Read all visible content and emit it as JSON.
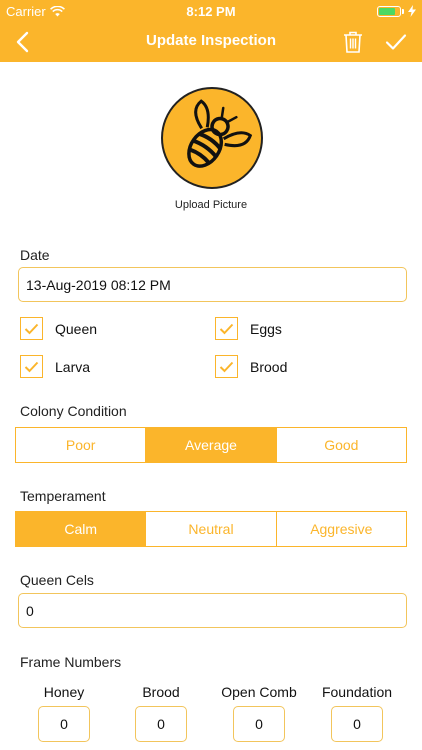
{
  "status_bar": {
    "carrier": "Carrier",
    "time": "8:12 PM"
  },
  "nav": {
    "title": "Update Inspection"
  },
  "photo": {
    "upload_label": "Upload Picture"
  },
  "date": {
    "label": "Date",
    "value": "13-Aug-2019 08:12 PM"
  },
  "checks": [
    {
      "label": "Queen",
      "checked": true
    },
    {
      "label": "Eggs",
      "checked": true
    },
    {
      "label": "Larva",
      "checked": true
    },
    {
      "label": "Brood",
      "checked": true
    }
  ],
  "colony_condition": {
    "label": "Colony Condition",
    "options": [
      "Poor",
      "Average",
      "Good"
    ],
    "selected": "Average"
  },
  "temperament": {
    "label": "Temperament",
    "options": [
      "Calm",
      "Neutral",
      "Aggresive"
    ],
    "selected": "Calm"
  },
  "queen_cells": {
    "label": "Queen Cels",
    "value": "0"
  },
  "frames": {
    "label": "Frame Numbers",
    "items": [
      {
        "label": "Honey",
        "value": "0"
      },
      {
        "label": "Brood",
        "value": "0"
      },
      {
        "label": "Open Comb",
        "value": "0"
      },
      {
        "label": "Foundation",
        "value": "0"
      }
    ]
  },
  "colors": {
    "accent": "#FBB52B",
    "field_border": "#F2C55C",
    "battery": "#4cd964"
  }
}
